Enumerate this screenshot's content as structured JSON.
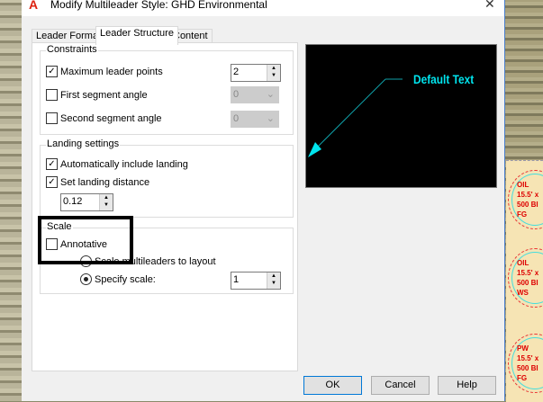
{
  "window": {
    "title": "Modify Multileader Style: GHD Environmental",
    "close_icon": "close-icon",
    "app_icon": "autocad-icon"
  },
  "tabs": [
    {
      "label": "Leader Format",
      "active": false
    },
    {
      "label": "Leader Structure",
      "active": true
    },
    {
      "label": "Content",
      "active": false
    }
  ],
  "constraints": {
    "label": "Constraints",
    "max_leader_points": {
      "label": "Maximum leader points",
      "checked": true,
      "value": "2"
    },
    "first_segment_angle": {
      "label": "First segment angle",
      "checked": false,
      "value": "0"
    },
    "second_segment_angle": {
      "label": "Second segment angle",
      "checked": false,
      "value": "0"
    }
  },
  "landing": {
    "label": "Landing settings",
    "auto_include": {
      "label": "Automatically include landing",
      "checked": true
    },
    "set_distance": {
      "label": "Set landing distance",
      "checked": true,
      "value": "0.12"
    }
  },
  "scale": {
    "label": "Scale",
    "annotative": {
      "label": "Annotative",
      "checked": false
    },
    "scale_to_layout": {
      "label": "Scale multileaders to layout",
      "selected": false
    },
    "specify_scale": {
      "label": "Specify scale:",
      "selected": true,
      "value": "1"
    }
  },
  "preview": {
    "text": "Default Text",
    "color": "#00e5ee"
  },
  "buttons": {
    "ok": "OK",
    "cancel": "Cancel",
    "help": "Help"
  },
  "map": {
    "tanks": [
      [
        "OIL",
        "15.5' x",
        "500 BI",
        "FG"
      ],
      [
        "OIL",
        "15.5' x",
        "500 BI",
        "WS"
      ],
      [
        "PW",
        "15.5' x",
        "500 BI",
        "FG"
      ]
    ]
  }
}
